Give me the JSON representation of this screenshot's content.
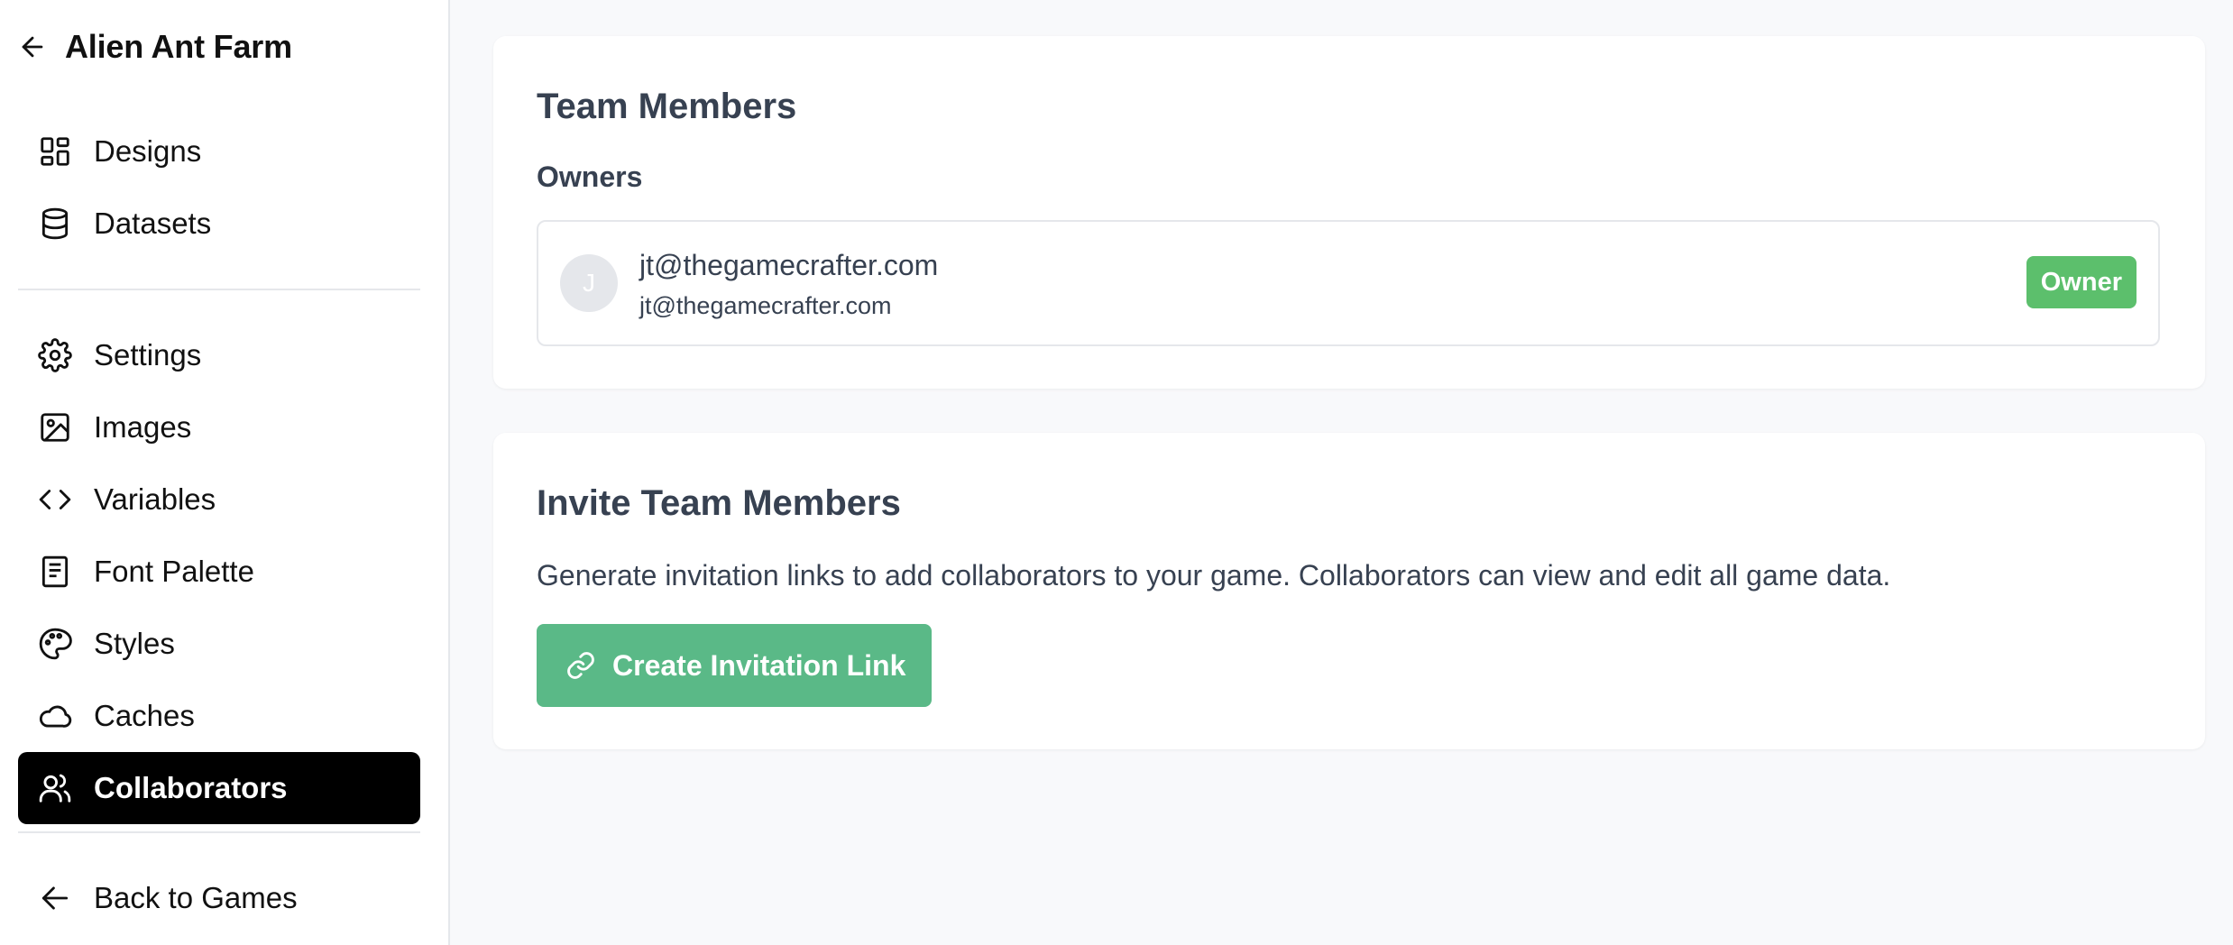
{
  "sidebar": {
    "title": "Alien Ant Farm",
    "primary": [
      {
        "label": "Designs",
        "icon": "grid-icon"
      },
      {
        "label": "Datasets",
        "icon": "database-icon"
      }
    ],
    "secondary": [
      {
        "label": "Settings",
        "icon": "gear-icon"
      },
      {
        "label": "Images",
        "icon": "image-icon"
      },
      {
        "label": "Variables",
        "icon": "code-icon"
      },
      {
        "label": "Font Palette",
        "icon": "book-icon"
      },
      {
        "label": "Styles",
        "icon": "palette-icon"
      },
      {
        "label": "Caches",
        "icon": "cloud-icon"
      },
      {
        "label": "Collaborators",
        "icon": "users-icon",
        "active": true
      }
    ],
    "footer": {
      "label": "Back to Games",
      "icon": "arrow-left-icon"
    }
  },
  "team": {
    "heading": "Team Members",
    "owners_label": "Owners",
    "owners": [
      {
        "initial": "J",
        "name": "jt@thegamecrafter.com",
        "email": "jt@thegamecrafter.com",
        "badge": "Owner"
      }
    ]
  },
  "invite": {
    "heading": "Invite Team Members",
    "description": "Generate invitation links to add collaborators to your game. Collaborators can view and edit all game data.",
    "button_label": "Create Invitation Link"
  },
  "colors": {
    "active_nav_bg": "#000000",
    "badge_green": "#5cbf6c",
    "button_green": "#5ab987"
  }
}
